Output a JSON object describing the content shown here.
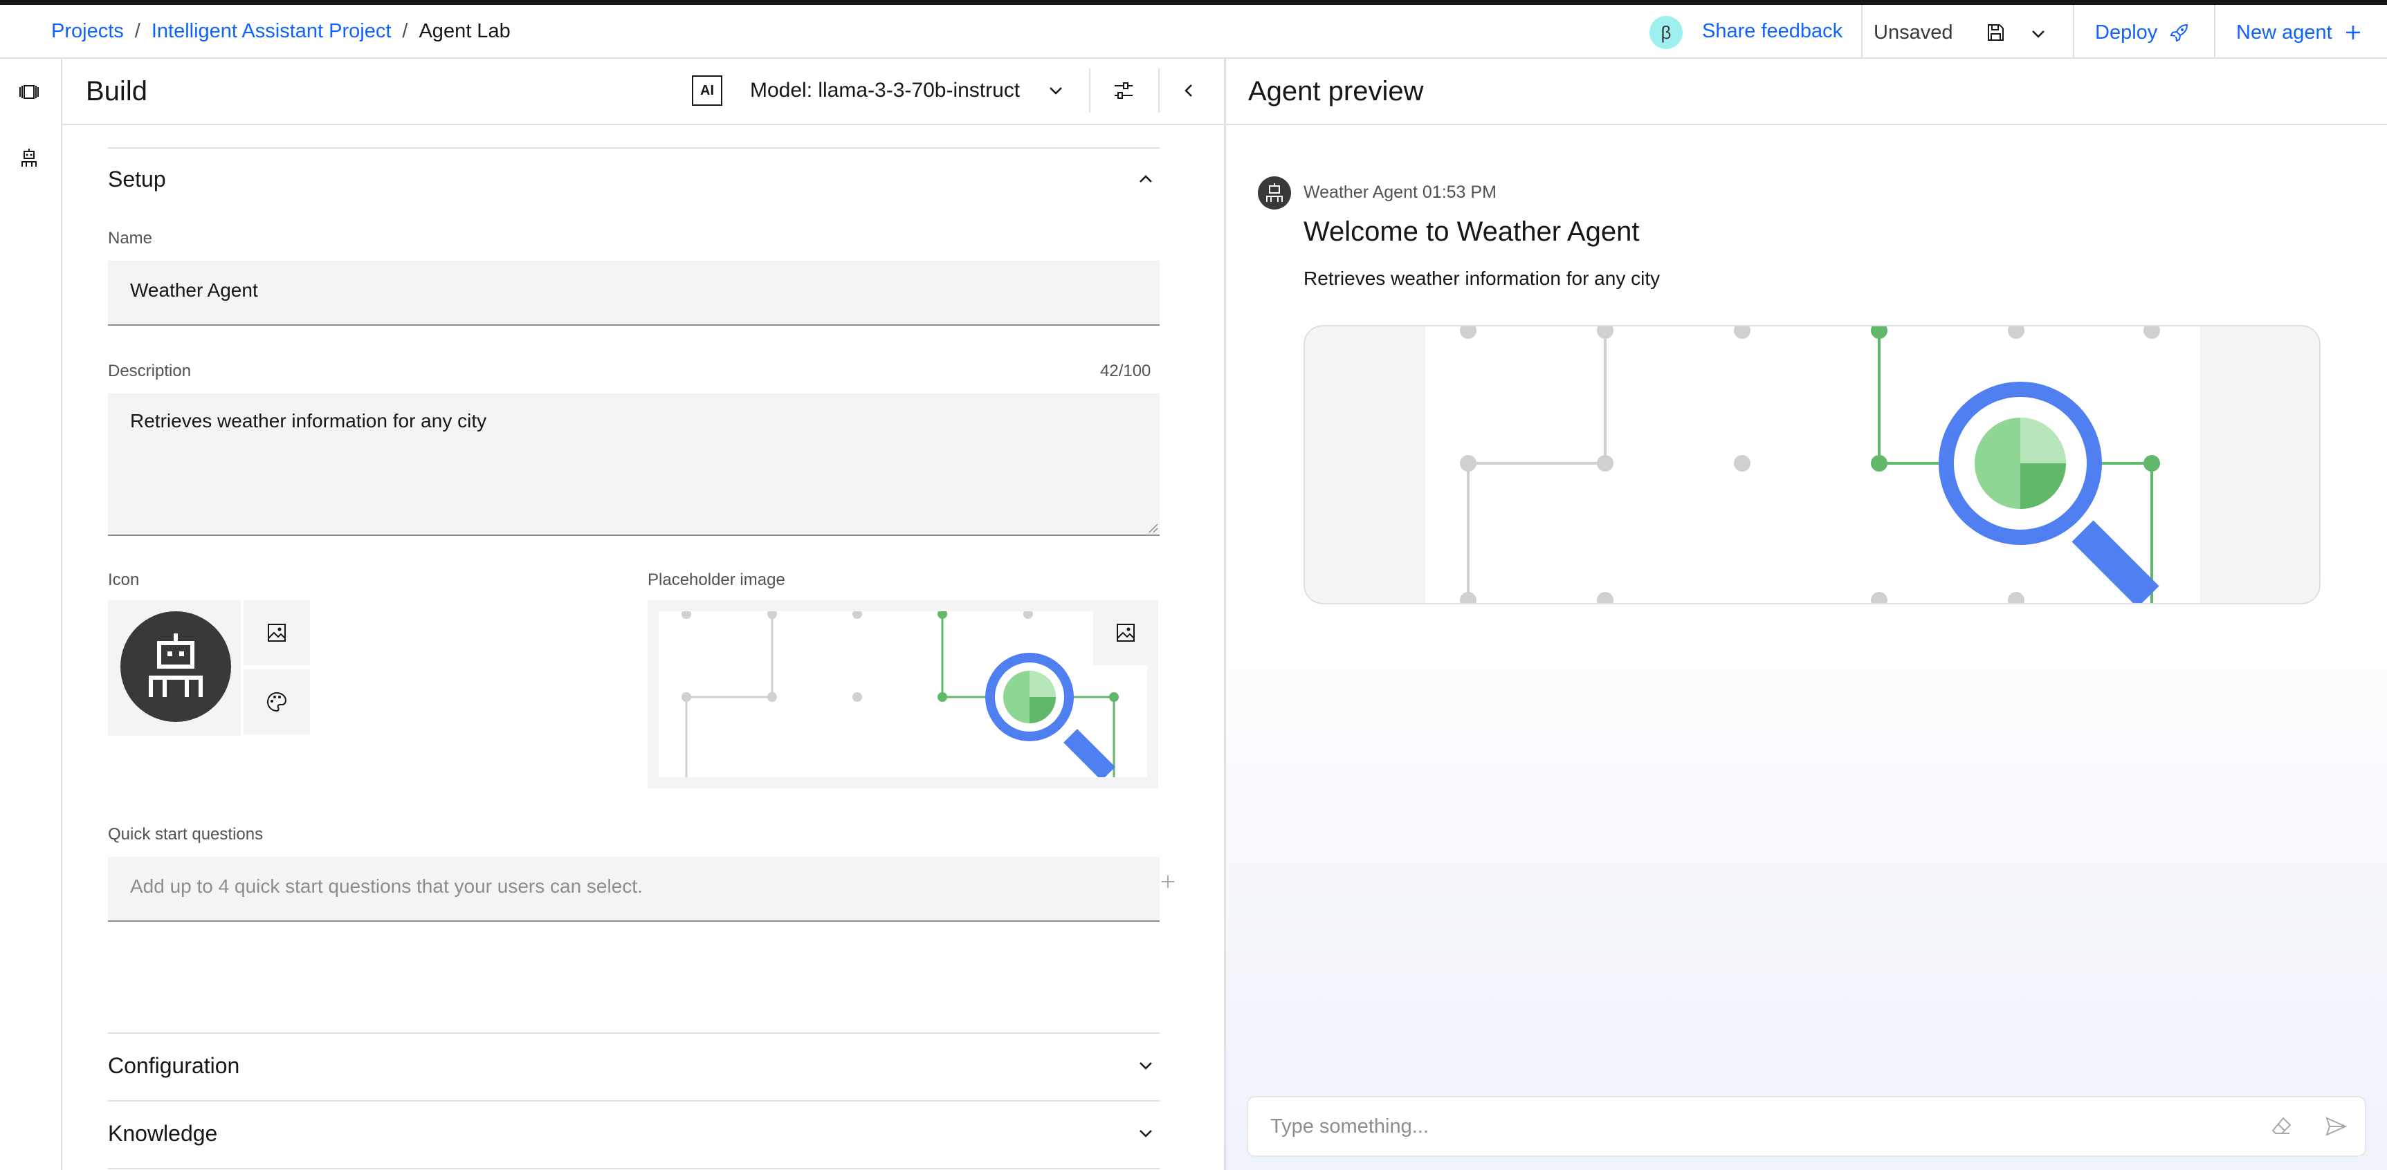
{
  "header": {
    "breadcrumbs": [
      "Projects",
      "Intelligent Assistant Project",
      "Agent Lab"
    ],
    "beta_badge": "β",
    "share_feedback": "Share feedback",
    "status": "Unsaved",
    "deploy_label": "Deploy",
    "new_agent_label": "New agent"
  },
  "build": {
    "title": "Build",
    "ai_badge": "AI",
    "model_label": "Model: llama-3-3-70b-instruct",
    "setup": {
      "title": "Setup",
      "name_label": "Name",
      "name_value": "Weather Agent",
      "description_label": "Description",
      "description_value": "Retrieves weather information for any city",
      "description_count": "42/100",
      "icon_label": "Icon",
      "placeholder_label": "Placeholder image",
      "quick_start_label": "Quick start questions",
      "quick_start_placeholder": "Add up to 4 quick start questions that your users can select."
    },
    "sections": [
      "Configuration",
      "Knowledge"
    ]
  },
  "preview": {
    "title": "Agent preview",
    "message": {
      "sender": "Weather Agent",
      "time": "01:53 PM",
      "title": "Welcome to Weather Agent",
      "body": "Retrieves weather information for any city"
    },
    "input_placeholder": "Type something..."
  },
  "colors": {
    "accent": "#0f62fe",
    "green": "#62b86a",
    "magnifier_blue": "#4f7ff0",
    "dark_avatar": "#393939"
  }
}
